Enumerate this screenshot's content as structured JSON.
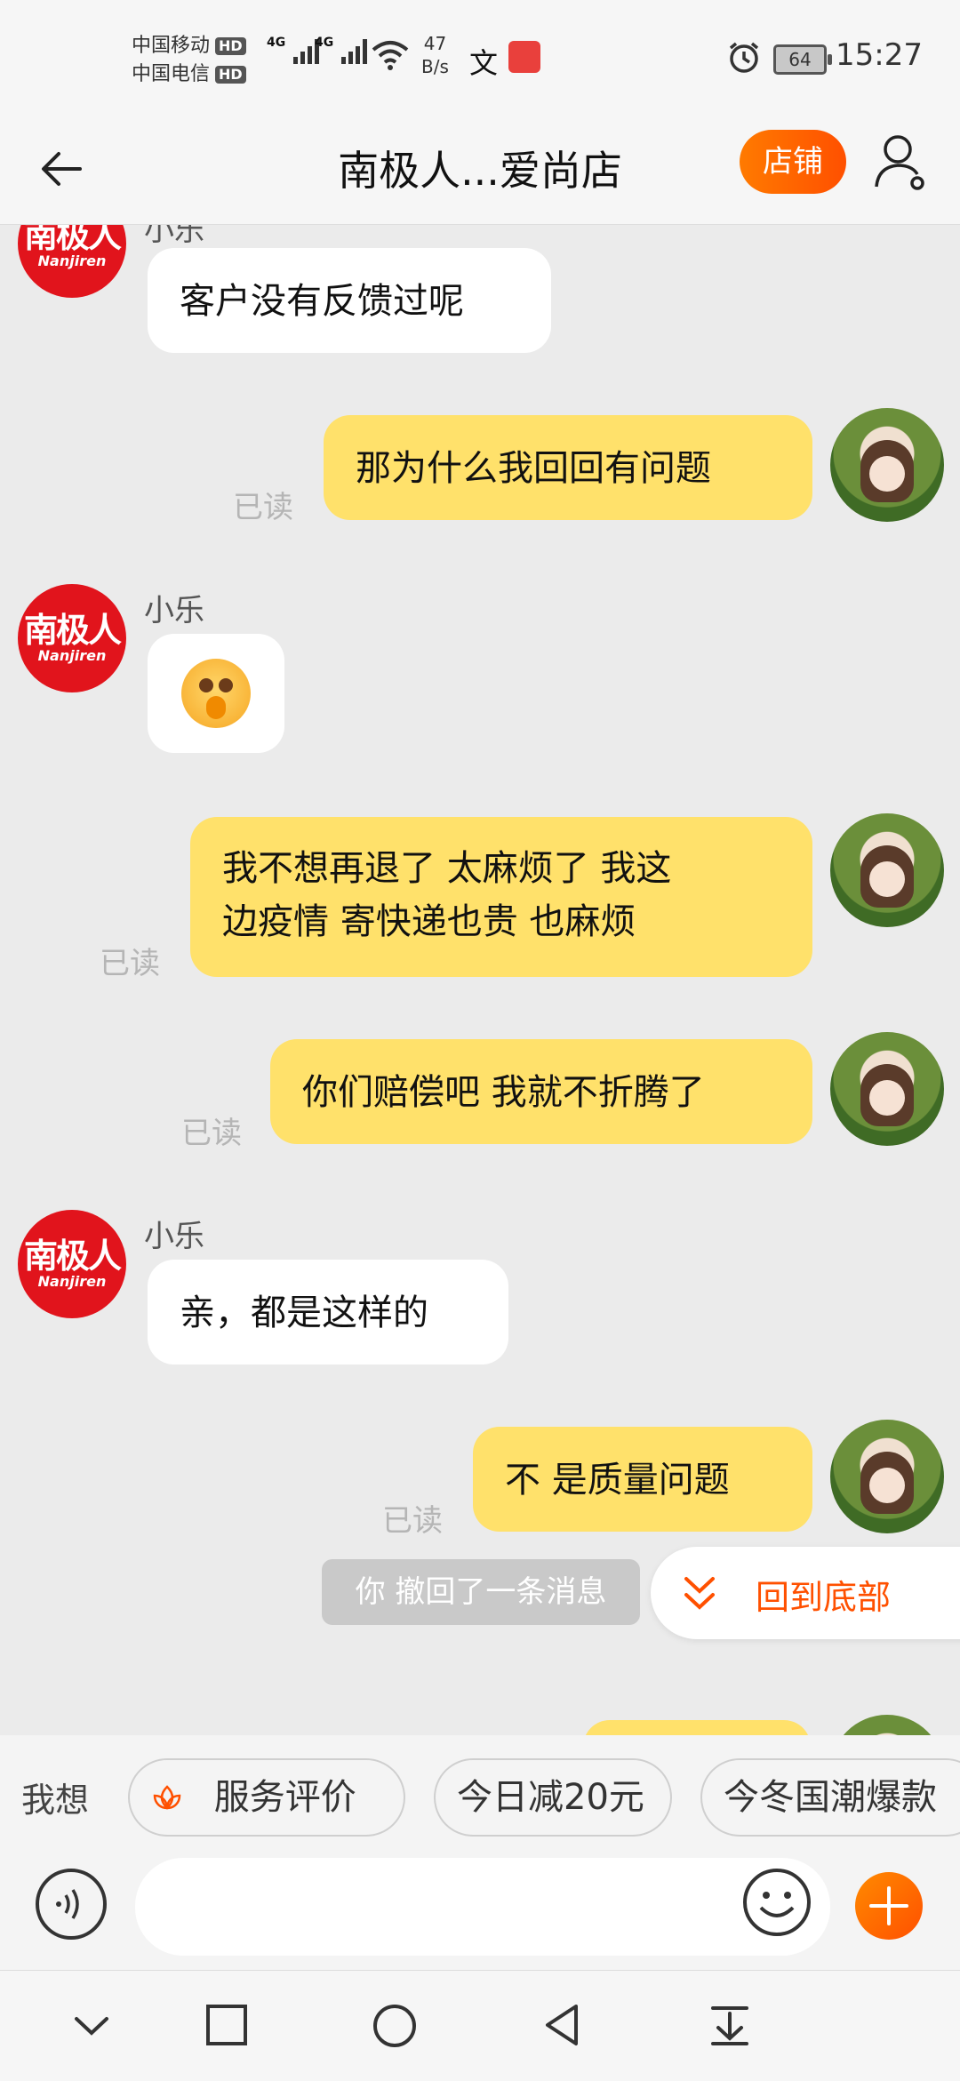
{
  "status": {
    "carrier1": "中国移动",
    "carrier2": "中国电信",
    "hd": "HD",
    "net1": "4G",
    "net2": "4G",
    "speed_value": "47",
    "speed_unit": "B/s",
    "battery": "64",
    "time": "15:27"
  },
  "header": {
    "title": "南极人...爱尚店",
    "shop_button": "店铺"
  },
  "shop_avatar": {
    "zh": "南极人",
    "en": "Nanjiren"
  },
  "messages": [
    {
      "from": "shop",
      "sender": "小乐",
      "text": "客户没有反馈过呢"
    },
    {
      "from": "me",
      "text": "那为什么我回回有问题",
      "status": "已读"
    },
    {
      "from": "shop",
      "sender": "小乐",
      "type": "emoji"
    },
    {
      "from": "me",
      "text_line1": "我不想再退了 太麻烦了 我这",
      "text_line2": "边疫情 寄快递也贵 也麻烦",
      "status": "已读"
    },
    {
      "from": "me",
      "text": "你们赔偿吧 我就不折腾了",
      "status": "已读"
    },
    {
      "from": "shop",
      "sender": "小乐",
      "text": "亲，都是这样的"
    },
    {
      "from": "me",
      "text": "不  是质量问题",
      "status": "已读"
    }
  ],
  "recall_notice": "你 撤回了一条消息",
  "to_bottom": "回到底部",
  "quickbar": {
    "label": "我想",
    "chips": [
      "服务评价",
      "今日减20元",
      "今冬国潮爆款"
    ]
  },
  "colors": {
    "accent": "#ff5000",
    "bubble_out": "#ffe16b",
    "bubble_in": "#ffffff",
    "background": "#ebebeb"
  }
}
